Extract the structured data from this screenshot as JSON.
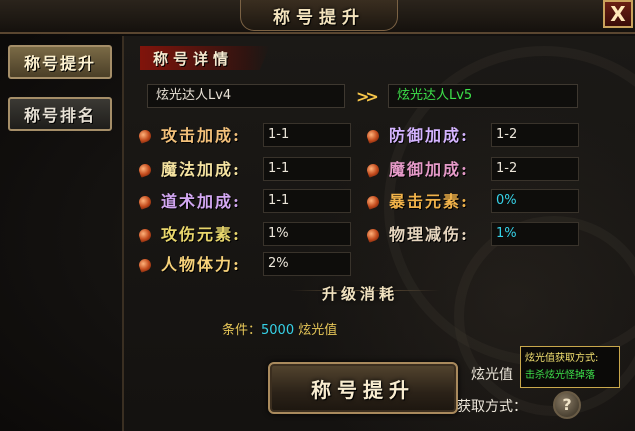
{
  "window": {
    "title": "称号提升",
    "close_label": "X"
  },
  "sidebar": {
    "tabs": [
      {
        "label": "称号提升",
        "active": true
      },
      {
        "label": "称号排名",
        "active": false
      }
    ]
  },
  "detail": {
    "section_title": "称号详情",
    "current_title": "炫光达人Lv4",
    "next_title": "炫光达人Lv5",
    "arrow": ">>",
    "stats": [
      {
        "label": "攻击加成:",
        "value": "1-1",
        "color": "#f2c07a",
        "value_color": "normal"
      },
      {
        "label": "防御加成:",
        "value": "1-2",
        "color": "#d4b4ff",
        "value_color": "normal"
      },
      {
        "label": "魔法加成:",
        "value": "1-1",
        "color": "#f4e2a0",
        "value_color": "normal"
      },
      {
        "label": "魔御加成:",
        "value": "1-2",
        "color": "#e59ac8",
        "value_color": "normal"
      },
      {
        "label": "道术加成:",
        "value": "1-1",
        "color": "#d2a7f2",
        "value_color": "normal"
      },
      {
        "label": "暴击元素:",
        "value": "0%",
        "color": "#f0b24a",
        "value_color": "cyan"
      },
      {
        "label": "攻伤元素:",
        "value": "1%",
        "color": "#e8d66c",
        "value_color": "normal"
      },
      {
        "label": "物理减伤:",
        "value": "1%",
        "color": "#e7d6bf",
        "value_color": "cyan"
      },
      {
        "label": "人物体力:",
        "value": "2%",
        "color": "#f7d27a",
        "value_color": "normal"
      }
    ]
  },
  "cost": {
    "section_title": "升级消耗",
    "condition_label": "条件：",
    "condition_value": "5000",
    "condition_unit": " 炫光值"
  },
  "actions": {
    "upgrade_label": "称号提升"
  },
  "info": {
    "xg_label": "炫光值",
    "tooltip_title": "炫光值获取方式:",
    "tooltip_body": "击杀炫光怪掉落",
    "obtain_label": "获取方式：",
    "help_label": "?"
  }
}
